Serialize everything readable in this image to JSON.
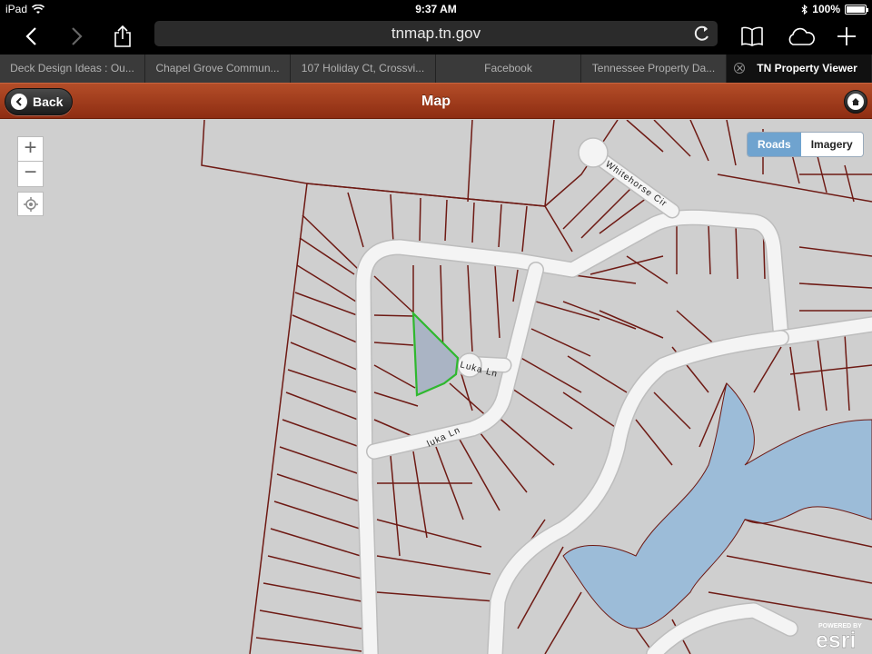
{
  "status_bar": {
    "device": "iPad",
    "time": "9:37 AM",
    "battery": "100%",
    "battery_level": 1.0
  },
  "browser": {
    "url": "tnmap.tn.gov",
    "tabs": [
      {
        "label": "Deck Design Ideas : Ou..."
      },
      {
        "label": "Chapel Grove Commun..."
      },
      {
        "label": "107 Holiday Ct, Crossvi..."
      },
      {
        "label": "Facebook"
      },
      {
        "label": "Tennessee Property Da..."
      },
      {
        "label": "TN Property Viewer",
        "active": true
      }
    ]
  },
  "header": {
    "back_label": "Back",
    "title": "Map"
  },
  "map": {
    "zoom_in": "+",
    "zoom_out": "−",
    "basemap_roads": "Roads",
    "basemap_imagery": "Imagery",
    "selected_basemap": "Roads",
    "road_labels": [
      "Whitehorse Cir",
      "Luka Ln",
      "luka Ln"
    ],
    "attribution_top": "POWERED BY",
    "attribution_brand": "esri",
    "colors": {
      "background": "#cfcfcf",
      "roads": "#f4f4f4",
      "parcel_lines": "#6e1a14",
      "water": "#9cbcd8",
      "selected_outline": "#2fb82f",
      "selected_fill": "#aab4c4"
    }
  }
}
